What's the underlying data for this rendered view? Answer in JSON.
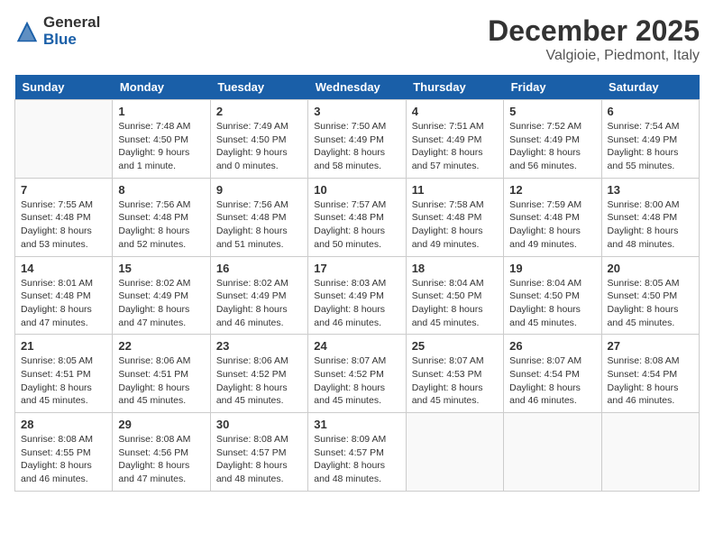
{
  "logo": {
    "general": "General",
    "blue": "Blue"
  },
  "title": "December 2025",
  "location": "Valgioie, Piedmont, Italy",
  "days_of_week": [
    "Sunday",
    "Monday",
    "Tuesday",
    "Wednesday",
    "Thursday",
    "Friday",
    "Saturday"
  ],
  "weeks": [
    [
      {
        "day": "",
        "info": ""
      },
      {
        "day": "1",
        "info": "Sunrise: 7:48 AM\nSunset: 4:50 PM\nDaylight: 9 hours\nand 1 minute."
      },
      {
        "day": "2",
        "info": "Sunrise: 7:49 AM\nSunset: 4:50 PM\nDaylight: 9 hours\nand 0 minutes."
      },
      {
        "day": "3",
        "info": "Sunrise: 7:50 AM\nSunset: 4:49 PM\nDaylight: 8 hours\nand 58 minutes."
      },
      {
        "day": "4",
        "info": "Sunrise: 7:51 AM\nSunset: 4:49 PM\nDaylight: 8 hours\nand 57 minutes."
      },
      {
        "day": "5",
        "info": "Sunrise: 7:52 AM\nSunset: 4:49 PM\nDaylight: 8 hours\nand 56 minutes."
      },
      {
        "day": "6",
        "info": "Sunrise: 7:54 AM\nSunset: 4:49 PM\nDaylight: 8 hours\nand 55 minutes."
      }
    ],
    [
      {
        "day": "7",
        "info": "Sunrise: 7:55 AM\nSunset: 4:48 PM\nDaylight: 8 hours\nand 53 minutes."
      },
      {
        "day": "8",
        "info": "Sunrise: 7:56 AM\nSunset: 4:48 PM\nDaylight: 8 hours\nand 52 minutes."
      },
      {
        "day": "9",
        "info": "Sunrise: 7:56 AM\nSunset: 4:48 PM\nDaylight: 8 hours\nand 51 minutes."
      },
      {
        "day": "10",
        "info": "Sunrise: 7:57 AM\nSunset: 4:48 PM\nDaylight: 8 hours\nand 50 minutes."
      },
      {
        "day": "11",
        "info": "Sunrise: 7:58 AM\nSunset: 4:48 PM\nDaylight: 8 hours\nand 49 minutes."
      },
      {
        "day": "12",
        "info": "Sunrise: 7:59 AM\nSunset: 4:48 PM\nDaylight: 8 hours\nand 49 minutes."
      },
      {
        "day": "13",
        "info": "Sunrise: 8:00 AM\nSunset: 4:48 PM\nDaylight: 8 hours\nand 48 minutes."
      }
    ],
    [
      {
        "day": "14",
        "info": "Sunrise: 8:01 AM\nSunset: 4:48 PM\nDaylight: 8 hours\nand 47 minutes."
      },
      {
        "day": "15",
        "info": "Sunrise: 8:02 AM\nSunset: 4:49 PM\nDaylight: 8 hours\nand 47 minutes."
      },
      {
        "day": "16",
        "info": "Sunrise: 8:02 AM\nSunset: 4:49 PM\nDaylight: 8 hours\nand 46 minutes."
      },
      {
        "day": "17",
        "info": "Sunrise: 8:03 AM\nSunset: 4:49 PM\nDaylight: 8 hours\nand 46 minutes."
      },
      {
        "day": "18",
        "info": "Sunrise: 8:04 AM\nSunset: 4:50 PM\nDaylight: 8 hours\nand 45 minutes."
      },
      {
        "day": "19",
        "info": "Sunrise: 8:04 AM\nSunset: 4:50 PM\nDaylight: 8 hours\nand 45 minutes."
      },
      {
        "day": "20",
        "info": "Sunrise: 8:05 AM\nSunset: 4:50 PM\nDaylight: 8 hours\nand 45 minutes."
      }
    ],
    [
      {
        "day": "21",
        "info": "Sunrise: 8:05 AM\nSunset: 4:51 PM\nDaylight: 8 hours\nand 45 minutes."
      },
      {
        "day": "22",
        "info": "Sunrise: 8:06 AM\nSunset: 4:51 PM\nDaylight: 8 hours\nand 45 minutes."
      },
      {
        "day": "23",
        "info": "Sunrise: 8:06 AM\nSunset: 4:52 PM\nDaylight: 8 hours\nand 45 minutes."
      },
      {
        "day": "24",
        "info": "Sunrise: 8:07 AM\nSunset: 4:52 PM\nDaylight: 8 hours\nand 45 minutes."
      },
      {
        "day": "25",
        "info": "Sunrise: 8:07 AM\nSunset: 4:53 PM\nDaylight: 8 hours\nand 45 minutes."
      },
      {
        "day": "26",
        "info": "Sunrise: 8:07 AM\nSunset: 4:54 PM\nDaylight: 8 hours\nand 46 minutes."
      },
      {
        "day": "27",
        "info": "Sunrise: 8:08 AM\nSunset: 4:54 PM\nDaylight: 8 hours\nand 46 minutes."
      }
    ],
    [
      {
        "day": "28",
        "info": "Sunrise: 8:08 AM\nSunset: 4:55 PM\nDaylight: 8 hours\nand 46 minutes."
      },
      {
        "day": "29",
        "info": "Sunrise: 8:08 AM\nSunset: 4:56 PM\nDaylight: 8 hours\nand 47 minutes."
      },
      {
        "day": "30",
        "info": "Sunrise: 8:08 AM\nSunset: 4:57 PM\nDaylight: 8 hours\nand 48 minutes."
      },
      {
        "day": "31",
        "info": "Sunrise: 8:09 AM\nSunset: 4:57 PM\nDaylight: 8 hours\nand 48 minutes."
      },
      {
        "day": "",
        "info": ""
      },
      {
        "day": "",
        "info": ""
      },
      {
        "day": "",
        "info": ""
      }
    ]
  ]
}
